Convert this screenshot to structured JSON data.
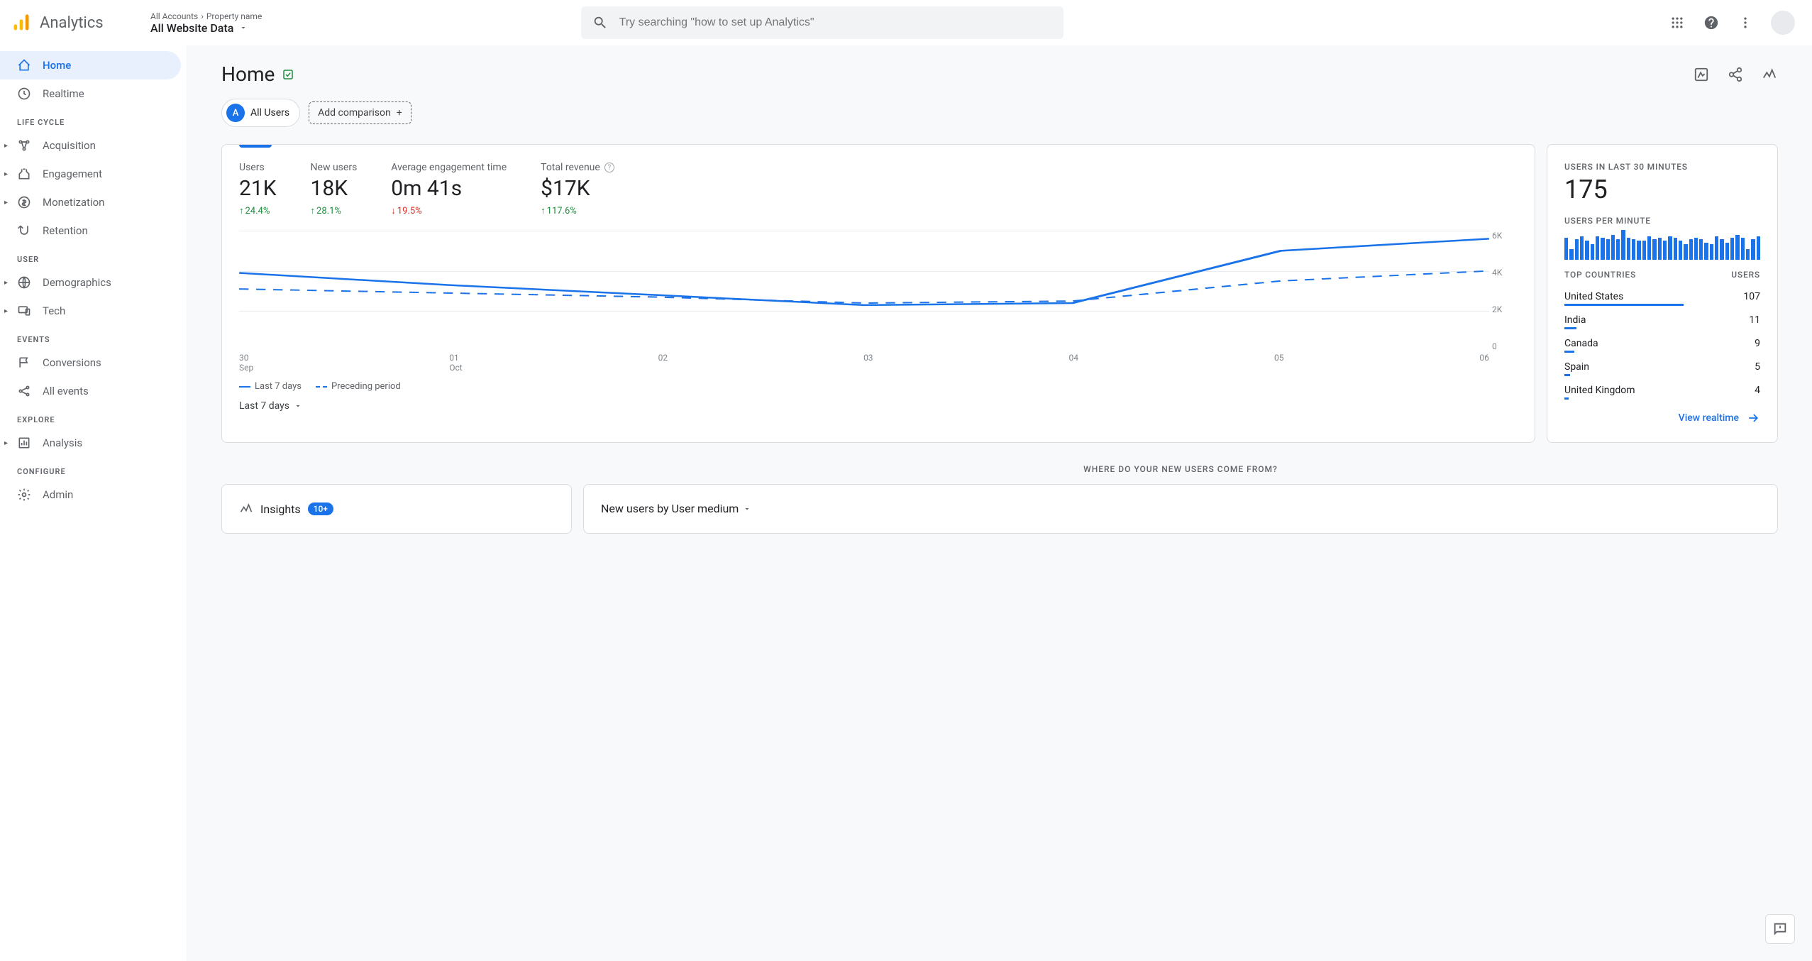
{
  "header": {
    "product": "Analytics",
    "breadcrumb1": "All Accounts",
    "breadcrumb2": "Property name",
    "property": "All Website Data",
    "search_placeholder": "Try searching \"how to set up Analytics\""
  },
  "sidebar": {
    "home": "Home",
    "realtime": "Realtime",
    "section_lifecycle": "LIFE CYCLE",
    "acquisition": "Acquisition",
    "engagement": "Engagement",
    "monetization": "Monetization",
    "retention": "Retention",
    "section_user": "USER",
    "demographics": "Demographics",
    "tech": "Tech",
    "section_events": "EVENTS",
    "conversions": "Conversions",
    "allevents": "All events",
    "section_explore": "EXPLORE",
    "analysis": "Analysis",
    "section_configure": "CONFIGURE",
    "admin": "Admin"
  },
  "page": {
    "title": "Home",
    "segment_letter": "A",
    "segment_label": "All Users",
    "add_comparison": "Add comparison"
  },
  "metrics": {
    "users": {
      "label": "Users",
      "value": "21K",
      "delta": "24.4%",
      "dir": "up"
    },
    "newusers": {
      "label": "New users",
      "value": "18K",
      "delta": "28.1%",
      "dir": "up"
    },
    "engagement": {
      "label": "Average engagement time",
      "value": "0m 41s",
      "delta": "19.5%",
      "dir": "down"
    },
    "revenue": {
      "label": "Total revenue",
      "value": "$17K",
      "delta": "117.6%",
      "dir": "up"
    }
  },
  "chart_data": {
    "type": "line",
    "ylim": [
      0,
      6000
    ],
    "y_ticks": [
      "6K",
      "4K",
      "2K",
      "0"
    ],
    "x_ticks": [
      {
        "d": "30",
        "m": "Sep"
      },
      {
        "d": "01",
        "m": "Oct"
      },
      {
        "d": "02",
        "m": ""
      },
      {
        "d": "03",
        "m": ""
      },
      {
        "d": "04",
        "m": ""
      },
      {
        "d": "05",
        "m": ""
      },
      {
        "d": "06",
        "m": ""
      }
    ],
    "series": [
      {
        "name": "Last 7 days",
        "style": "solid",
        "values": [
          3900,
          3300,
          2800,
          2300,
          2400,
          5000,
          5600
        ]
      },
      {
        "name": "Preceding period",
        "style": "dashed",
        "values": [
          3100,
          2900,
          2700,
          2400,
          2500,
          3500,
          4000
        ]
      }
    ]
  },
  "legend": {
    "a": "Last 7 days",
    "b": "Preceding period"
  },
  "date_range": "Last 7 days",
  "realtime": {
    "label1": "USERS IN LAST 30 MINUTES",
    "value": "175",
    "label2": "USERS PER MINUTE",
    "spark": [
      28,
      14,
      26,
      30,
      24,
      20,
      30,
      28,
      26,
      32,
      26,
      38,
      28,
      26,
      24,
      24,
      30,
      26,
      28,
      24,
      30,
      28,
      24,
      20,
      26,
      28,
      26,
      22,
      20,
      30,
      26,
      22,
      28,
      32,
      28,
      14,
      26,
      30
    ],
    "header_country": "TOP COUNTRIES",
    "header_users": "USERS",
    "countries": [
      {
        "name": "United States",
        "users": "107",
        "pct": 61
      },
      {
        "name": "India",
        "users": "11",
        "pct": 6
      },
      {
        "name": "Canada",
        "users": "9",
        "pct": 5
      },
      {
        "name": "Spain",
        "users": "5",
        "pct": 3
      },
      {
        "name": "United Kingdom",
        "users": "4",
        "pct": 2
      }
    ],
    "link": "View realtime"
  },
  "section2_label": "WHERE DO YOUR NEW USERS COME FROM?",
  "insights": {
    "label": "Insights",
    "badge": "10+"
  },
  "medium": {
    "label": "New users by User medium"
  }
}
